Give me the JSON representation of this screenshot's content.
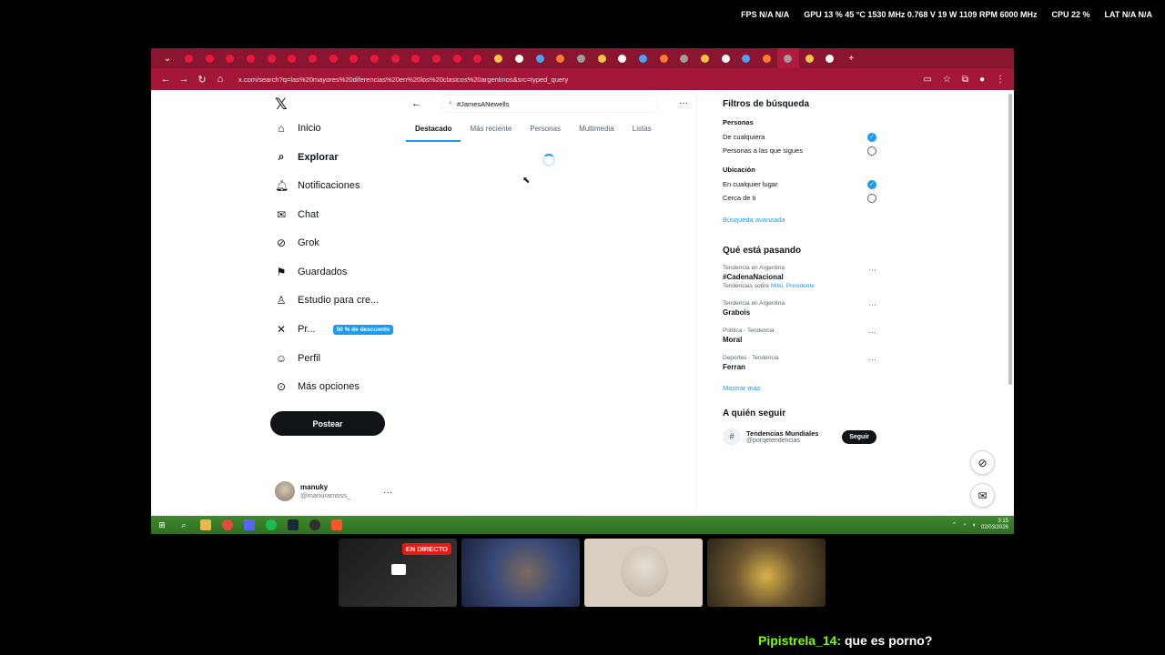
{
  "overlay": {
    "fps": "FPS  N/A  N/A",
    "gpu": "GPU  13 %  45 °C  1530 MHz  0.768 V  19 W  1109 RPM  6000 MHz",
    "cpu": "CPU  22 %",
    "lat": "LAT  N/A  N/A"
  },
  "browser": {
    "url": "x.com/search?q=las%20mayores%20diferencias%20en%20los%20clasicos%20argentinos&src=typed_query",
    "tab_count": 32
  },
  "nav": {
    "logo": "𝕏",
    "items": [
      {
        "label": "Inicio",
        "icon": "home-icon",
        "glyph": "⌂"
      },
      {
        "label": "Explorar",
        "icon": "search-icon",
        "glyph": "⌕",
        "bold": true
      },
      {
        "label": "Notificaciones",
        "icon": "bell-icon",
        "glyph": "🔔︎"
      },
      {
        "label": "Chat",
        "icon": "mail-icon",
        "glyph": "✉"
      },
      {
        "label": "Grok",
        "icon": "grok-icon",
        "glyph": "⊘"
      },
      {
        "label": "Guardados",
        "icon": "bookmark-icon",
        "glyph": "⚑"
      },
      {
        "label": "Estudio para cre...",
        "icon": "studio-icon",
        "glyph": "♙"
      },
      {
        "label": "Pr...",
        "icon": "x-premium-icon",
        "glyph": "✕"
      },
      {
        "label": "Perfil",
        "icon": "person-icon",
        "glyph": "☺"
      },
      {
        "label": "Más opciones",
        "icon": "more-circle-icon",
        "glyph": "⊙"
      }
    ],
    "premium_badge": "50 % de descuento",
    "post_button": "Postear",
    "user": {
      "name": "manuky",
      "handle": "@manuramoss_"
    }
  },
  "center": {
    "search_value": "#JamesANewells",
    "tabs": [
      "Destacado",
      "Más reciente",
      "Personas",
      "Multimedia",
      "Listas"
    ]
  },
  "filters": {
    "title": "Filtros de búsqueda",
    "people_label": "Personas",
    "people_options": [
      "De cualquiera",
      "Personas a las que sigues"
    ],
    "location_label": "Ubicación",
    "location_options": [
      "En cualquier lugar",
      "Cerca de ti"
    ],
    "advanced": "Búsqueda avanzada"
  },
  "trends": {
    "title": "Qué está pasando",
    "items": [
      {
        "meta": "Tendencia en Argentina",
        "name": "#CadenaNacional",
        "about_prefix": "Tendencias sobre ",
        "about_links": "Milei, Presidente"
      },
      {
        "meta": "Tendencia en Argentina",
        "name": "Grabois"
      },
      {
        "meta": "Política · Tendencia",
        "name": "Moral"
      },
      {
        "meta": "Deportes · Tendencia",
        "name": "Ferran"
      }
    ],
    "show_more": "Mostrar más"
  },
  "who_to_follow": {
    "title": "A quién seguir",
    "name": "Tendencias Mundiales",
    "handle": "@porqetendencias",
    "button": "Seguir"
  },
  "taskbar": {
    "time": "3:15",
    "date": "02/03/2026"
  },
  "stream": {
    "live_badge": "EN DIRECTO",
    "chat_user": "Pipistrela_14:",
    "chat_message": " que es porno?"
  },
  "colors": {
    "accent": "#1d9bf0",
    "browser_frame": "#8a1530",
    "live": "#e91916"
  }
}
